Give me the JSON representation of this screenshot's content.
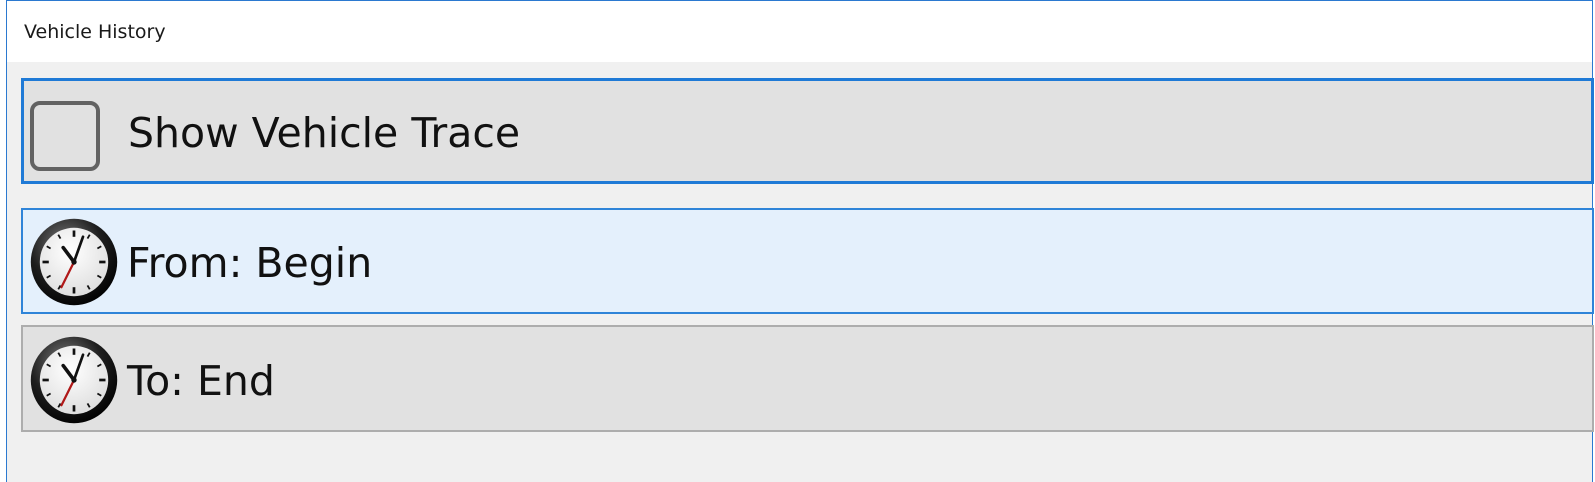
{
  "window": {
    "title": "Vehicle History"
  },
  "trace": {
    "label": "Show Vehicle Trace",
    "checked": false
  },
  "from": {
    "label": "From: Begin",
    "icon": "clock-icon"
  },
  "to": {
    "label": "To: End",
    "icon": "clock-icon"
  },
  "colors": {
    "focus_border": "#1f7ad6",
    "selected_bg": "#e4f0fc",
    "row_bg": "#e1e1e1",
    "window_bg": "#f0f0f0"
  }
}
